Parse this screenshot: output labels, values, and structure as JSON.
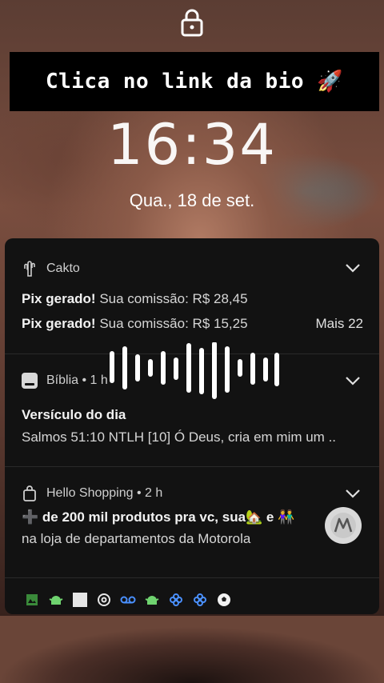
{
  "overlay": {
    "banner_text": "Clica no link da bio 🚀"
  },
  "lockscreen": {
    "time": "16:34",
    "date": "Qua., 18 de set."
  },
  "notifications": [
    {
      "app": "Cakto",
      "lines": [
        {
          "bold": "Pix gerado!",
          "text": " Sua comissão: R$ 28,45"
        },
        {
          "bold": "Pix gerado!",
          "text": " Sua comissão: R$ 15,25"
        }
      ],
      "more": "Mais 22"
    },
    {
      "app": "Bíblia",
      "time": " • 1 h",
      "title": "Versículo do dia",
      "text": "Salmos 51:10 NTLH [10] Ó Deus, cria em mim um .."
    },
    {
      "app": "Hello Shopping",
      "time": " • 2 h",
      "title": "➕ de 200 mil produtos pra vc, sua🏡 e 👫",
      "text": "na loja de departamentos da Motorola"
    }
  ],
  "status_icons": [
    "gallery-icon",
    "android-icon",
    "white-square-icon",
    "threads-icon",
    "voicemail-icon",
    "android-icon",
    "pinwheel-icon",
    "pinwheel-icon",
    "soccer-ball-icon"
  ],
  "colors": {
    "panel": "#121212",
    "accent_green": "#6fd36f",
    "accent_blue": "#4a90ff"
  }
}
